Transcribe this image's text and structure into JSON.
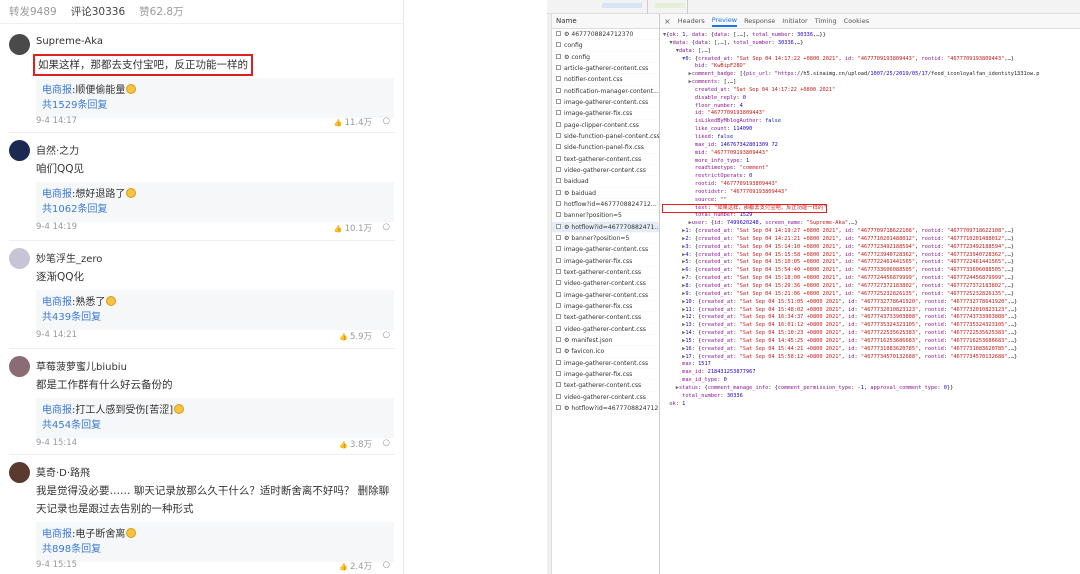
{
  "weibo": {
    "stats": {
      "repost": "转发9489",
      "comment": "评论30336",
      "like": "赞62.8万"
    },
    "comments": [
      {
        "user": "Supreme-Aka",
        "text": "如果这样，那都去支付宝吧，反正功能一样的",
        "reply": {
          "name": "电商报",
          "text": ":顺便偷能量",
          "more": "共1529条回复"
        },
        "time": "9-4 14:17",
        "likes": "11.4万",
        "avatar_color": "#4a4a4a"
      },
      {
        "user": "自然·之力",
        "text": "咱们QQ见",
        "reply": {
          "name": "电商报",
          "text": ":想好退路了",
          "more": "共1062条回复"
        },
        "time": "9-4 14:19",
        "likes": "10.1万",
        "avatar_color": "#1c2a52"
      },
      {
        "user": "妙笔浮生_zero",
        "text": "逐渐QQ化",
        "reply": {
          "name": "电商报",
          "text": ":熟悉了",
          "more": "共439条回复"
        },
        "time": "9-4 14:21",
        "likes": "5.9万",
        "avatar_color": "#c7c4d8"
      },
      {
        "user": "草莓菠萝蜜儿biubiu",
        "text": "都是工作群有什么好云备份的",
        "reply": {
          "name": "电商报",
          "text": ":打工人感到受伤[苦涩]",
          "more": "共454条回复"
        },
        "time": "9-4 15:14",
        "likes": "3.8万",
        "avatar_color": "#8b6b74"
      },
      {
        "user": "莫奇·D·路飛",
        "text": "我是觉得没必要…… 聊天记录放那么久干什么？适时断舍离不好吗？ 删除聊天记录也是跟过去告别的一种形式",
        "reply": {
          "name": "电商报",
          "text": ":电子断舍离",
          "more": "共898条回复"
        },
        "time": "9-4 15:15",
        "likes": "2.4万",
        "avatar_color": "#5a3a2e"
      }
    ]
  },
  "devtools": {
    "name_header": "Name",
    "files": [
      "⚙ 4677708824712370",
      "config",
      "⚙ config",
      "article-gatherer-content.css",
      "notifier-content.css",
      "notification-manager-content...",
      "image-gatherer-content.css",
      "image-gatherer-fix.css",
      "page-clipper-content.css",
      "side-function-panel-content.css",
      "side-function-panel-fix.css",
      "text-gatherer-content.css",
      "video-gatherer-content.css",
      "baiduad",
      "⚙ baiduad",
      "hotflow?id=4677708824712...",
      "banner?position=5",
      "⚙ hotflow?id=467770882471...",
      "⚙ banner?position=5",
      "image-gatherer-content.css",
      "image-gatherer-fix.css",
      "text-gatherer-content.css",
      "video-gatherer-content.css",
      "image-gatherer-content.css",
      "image-gatherer-fix.css",
      "text-gatherer-content.css",
      "video-gatherer-content.css",
      "⚙ manifest.json",
      "⚙ favicon.ico",
      "image-gatherer-content.css",
      "image-gatherer-fix.css",
      "text-gatherer-content.css",
      "video-gatherer-content.css",
      "⚙ hotflow?id=4677708824712..."
    ],
    "selected_index": 17,
    "tabs": [
      "Headers",
      "Preview",
      "Response",
      "Initiator",
      "Timing",
      "Cookies"
    ],
    "active_tab": "Preview",
    "close_glyph": "×",
    "lines": [
      "▼{ok: 1, data: {data: [,…], total_number: 30336,…}}",
      "  ▼data: {data: [,…], total_number: 30336,…}",
      "    ▼data: [,…]",
      "      ▼0: {created_at: \"Sat Sep 04 14:17:22 +0800 2021\", id: \"4677709193809443\", rootid: \"4677709193809443\",…}",
      "          bid: \"KwBipF28D\"",
      "        ▶comment_badge: [{pic_url: \"https://h5.sinaimg.cn/upload/1007/25/2019/05/17/feed_iconloyalfan_identity1331ow.p",
      "        ▶comments: [,…]",
      "          created_at: \"Sat Sep 04 14:17:22 +0800 2021\"",
      "          disable_reply: 0",
      "          floor_number: 4",
      "          id: \"4677709193809443\"",
      "          isLikedByMblogAuthor: false",
      "          like_count: 114090",
      "          liked: false",
      "          max_id: 146767342801309 72",
      "          mid: \"4677709193809443\"",
      "          more_info_type: 1",
      "          readtimetype: \"comment\"",
      "          restrictOperate: 0",
      "          rootid: \"4677709193809443\"",
      "          rootidstr: \"4677709193809443\"",
      "          source: \"\"",
      "          text: \"如果这样，那都去支付宝吧，反正功能一样的\"",
      "          total_number: 1529",
      "        ▶user: {id: 7499620248, screen_name: \"Supreme-Aka\",…}",
      "      ▶1: {created_at: \"Sat Sep 04 14:19:27 +0800 2021\", id: \"4677709718622108\", rootid: \"4677709718622108\",…}",
      "      ▶2: {created_at: \"Sat Sep 04 14:21:21 +0800 2021\", id: \"4677710201488012\", rootid: \"4677710201488012\",…}",
      "      ▶3: {created_at: \"Sat Sep 04 15:14:10 +0800 2021\", id: \"4677723492188594\", rootid: \"4677723492188594\",…}",
      "      ▶4: {created_at: \"Sat Sep 04 15:15:58 +0800 2021\", id: \"4677723940728362\", rootid: \"4677723940728362\",…}",
      "      ▶5: {created_at: \"Sat Sep 04 15:10:05 +0800 2021\", id: \"4677722461441565\", rootid: \"4677722461441565\",…}",
      "      ▶6: {created_at: \"Sat Sep 04 15:54:40 +0800 2021\", id: \"4677733606088505\", rootid: \"4677733606088505\",…}",
      "      ▶7: {created_at: \"Sat Sep 04 15:18:00 +0800 2021\", id: \"4677724456879999\", rootid: \"4677724456879999\",…}",
      "      ▶8: {created_at: \"Sat Sep 04 15:29:36 +0800 2021\", id: \"4677727372183802\", rootid: \"4677727372183802\",…}",
      "      ▶9: {created_at: \"Sat Sep 04 15:21:06 +0800 2021\", id: \"4677725232826135\", rootid: \"4677725232826135\",…}",
      "      ▶10: {created_at: \"Sat Sep 04 15:51:05 +0800 2021\", id: \"4677732778641920\", rootid: \"4677732778641920\",…}",
      "      ▶11: {created_at: \"Sat Sep 04 15:48:02 +0800 2021\", id: \"4677732010823123\", rootid: \"4677732010823123\",…}",
      "      ▶12: {created_at: \"Sat Sep 04 16:34:37 +0800 2021\", id: \"4677743733903808\", rootid: \"4677743733903808\",…}",
      "      ▶13: {created_at: \"Sat Sep 04 16:01:12 +0800 2021\", id: \"4677735324323105\", rootid: \"4677735324323105\",…}",
      "      ▶14: {created_at: \"Sat Sep 04 15:10:23 +0800 2021\", id: \"4677722535625383\", rootid: \"4677722535625383\",…}",
      "      ▶15: {created_at: \"Sat Sep 04 14:45:25 +0800 2021\", id: \"4677716253686683\", rootid: \"4677716253686683\",…}",
      "      ▶16: {created_at: \"Sat Sep 04 15:44:21 +0800 2021\", id: \"4677731083620785\", rootid: \"4677731083620785\",…}",
      "      ▶17: {created_at: \"Sat Sep 04 15:58:12 +0800 2021\", id: \"4677734570132688\", rootid: \"4677734570132688\",…}",
      "      max: 1517",
      "      max_id: 218431253877967",
      "      max_id_type: 0",
      "    ▶status: {comment_manage_info: {comment_permission_type: -1, approval_comment_type: 0}}",
      "      total_number: 30336",
      "  ok: 1"
    ],
    "highlight_line": 22
  }
}
